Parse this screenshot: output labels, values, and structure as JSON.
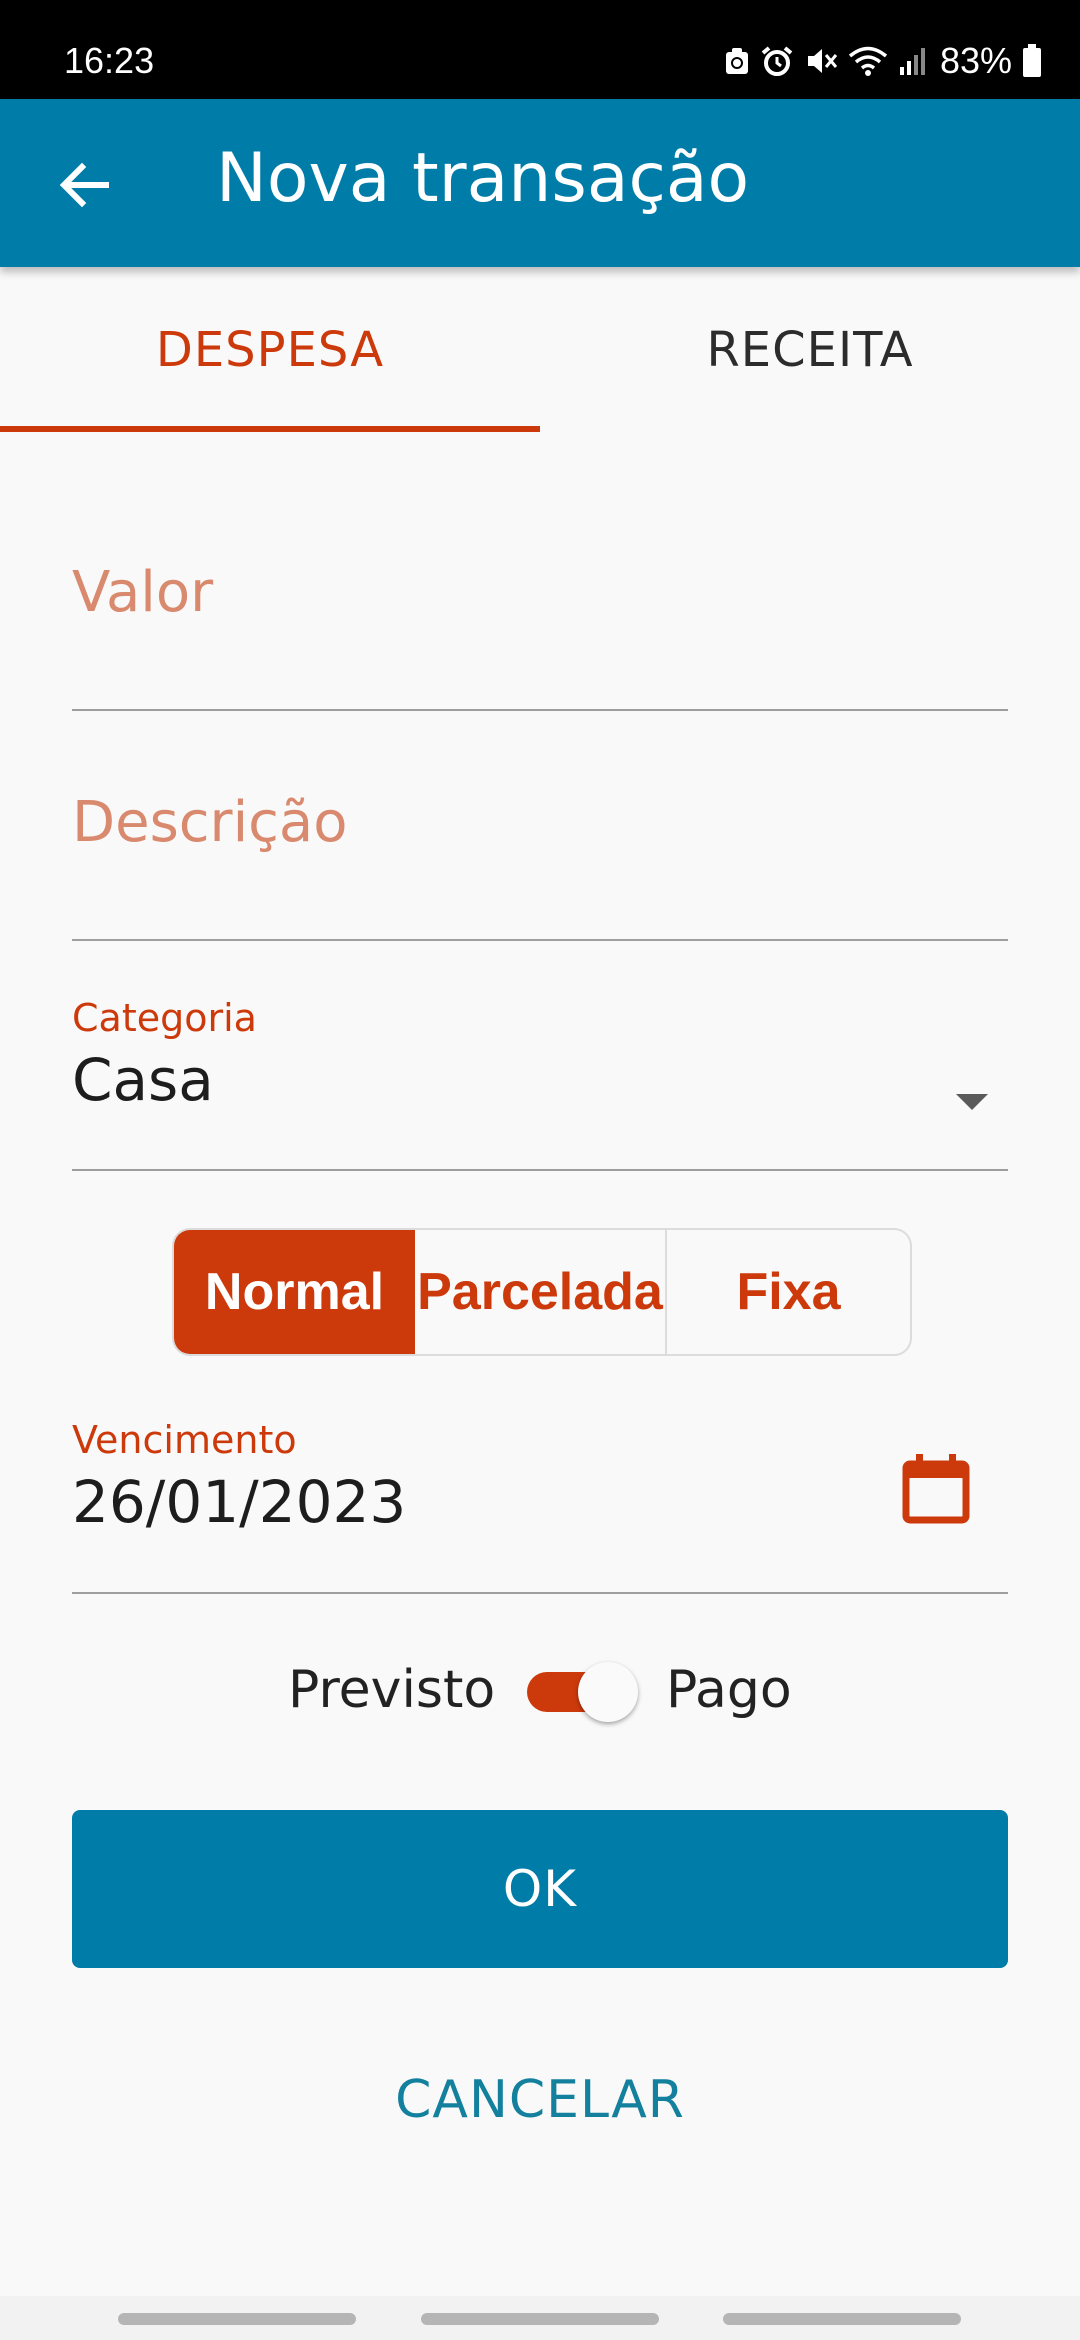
{
  "status": {
    "time": "16:23",
    "battery": "83%"
  },
  "appbar": {
    "title": "Nova transação",
    "back_icon": "arrow-left-icon"
  },
  "tabs": [
    {
      "label": "DESPESA",
      "selected": true
    },
    {
      "label": "RECEITA",
      "selected": false
    }
  ],
  "form": {
    "valor_placeholder": "Valor",
    "descricao_placeholder": "Descrição",
    "categoria_label": "Categoria",
    "categoria_value": "Casa",
    "types": [
      {
        "label": "Normal",
        "selected": true
      },
      {
        "label": "Parcelada",
        "selected": false
      },
      {
        "label": "Fixa",
        "selected": false
      }
    ],
    "vencimento_label": "Vencimento",
    "vencimento_value": "26/01/2023",
    "switch_left_label": "Previsto",
    "switch_right_label": "Pago",
    "switch_on": true
  },
  "buttons": {
    "ok": "OK",
    "cancel": "CANCELAR"
  },
  "colors": {
    "primary": "#007ca8",
    "accent": "#cc3a0c",
    "placeholder": "#d98a6e",
    "background": "#f9f9f9"
  }
}
